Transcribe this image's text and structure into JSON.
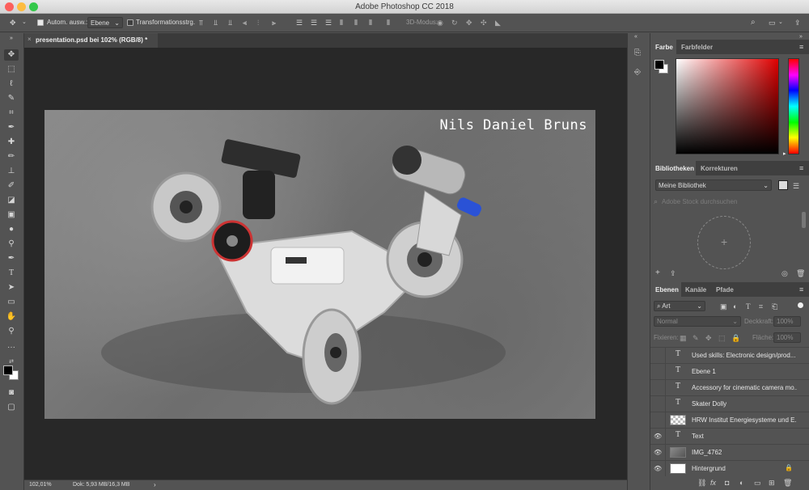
{
  "window": {
    "title": "Adobe Photoshop CC 2018"
  },
  "options_bar": {
    "auto_select_label": "Autom. ausw.:",
    "auto_select_checked": true,
    "auto_select_target": "Ebene",
    "transform_label": "Transformationsstrg.",
    "transform_checked": false,
    "mode_3d_label": "3D-Modus:"
  },
  "document": {
    "tab_label": "presentation.psd bei 102% (RGB/8) *",
    "overlay_text": "Nils Daniel Bruns"
  },
  "status": {
    "zoom": "102,01%",
    "doc_info": "Dok: 5,93 MB/16,3 MB"
  },
  "panels": {
    "color": {
      "tabs": [
        "Farbe",
        "Farbfelder"
      ],
      "active_hue": "#e00000"
    },
    "libraries": {
      "tabs": [
        "Bibliotheken",
        "Korrekturen"
      ],
      "library_name": "Meine Bibliothek",
      "search_placeholder": "Adobe Stock durchsuchen"
    },
    "layers": {
      "tabs": [
        "Ebenen",
        "Kanäle",
        "Pfade"
      ],
      "filter_kind": "Art",
      "blend_mode": "Normal",
      "opacity_label": "Deckkraft:",
      "opacity_value": "100%",
      "lock_label": "Fixieren:",
      "fill_label": "Fläche:",
      "fill_value": "100%",
      "items": [
        {
          "name": "Used skills: Electronic design/prod...",
          "type": "text",
          "visible": false
        },
        {
          "name": "Ebene 1",
          "type": "text",
          "visible": false
        },
        {
          "name": "Accessory for cinematic camera mo...",
          "type": "text",
          "visible": false
        },
        {
          "name": "Skater Dolly",
          "type": "text",
          "visible": false
        },
        {
          "name": "HRW Institut Energiesysteme und E...",
          "type": "smart",
          "visible": false
        },
        {
          "name": "Text",
          "type": "text",
          "visible": true
        },
        {
          "name": "IMG_4762",
          "type": "smart",
          "visible": true
        },
        {
          "name": "Hintergrund",
          "type": "background",
          "visible": true
        }
      ]
    }
  }
}
